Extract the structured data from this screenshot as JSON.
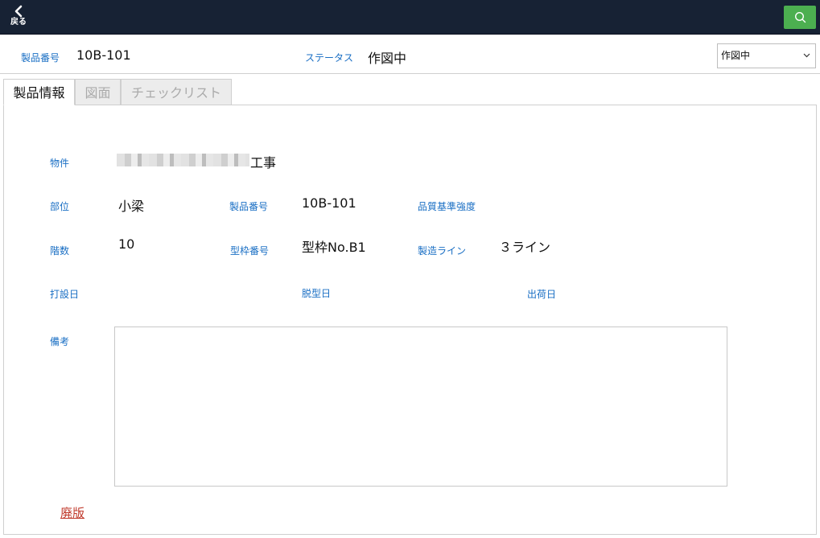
{
  "topbar": {
    "back_label": "戻る",
    "icons": {
      "back": "chevron-left-icon",
      "search": "search-icon"
    },
    "search_color": "#4caf50",
    "bar_color": "#172234"
  },
  "header": {
    "product_no_label": "製品番号",
    "product_no_value": "10B-101",
    "status_label": "ステータス",
    "status_value": "作図中",
    "status_select_value": "作図中"
  },
  "tabs": [
    {
      "label": "製品情報",
      "active": true
    },
    {
      "label": "図面",
      "active": false
    },
    {
      "label": "チェックリスト",
      "active": false
    }
  ],
  "info": {
    "property_label": "物件",
    "property_value_suffix": "工事",
    "part_label": "部位",
    "part_value": "小梁",
    "product_no_label": "製品番号",
    "product_no_value": "10B-101",
    "quality_label": "品質基準強度",
    "quality_value": "",
    "floor_label": "階数",
    "floor_value": "10",
    "mold_no_label": "型枠番号",
    "mold_no_value": "型枠No.B1",
    "line_label": "製造ライン",
    "line_value": "３ライン",
    "casting_date_label": "打設日",
    "casting_date_value": "",
    "demold_date_label": "脱型日",
    "demold_date_value": "",
    "shipping_date_label": "出荷日",
    "shipping_date_value": "",
    "memo_label": "備考",
    "memo_value": ""
  },
  "footer": {
    "obsolete_link": "廃版"
  },
  "colors": {
    "label_blue": "#1a6fc4",
    "link_red": "#c0392b"
  }
}
